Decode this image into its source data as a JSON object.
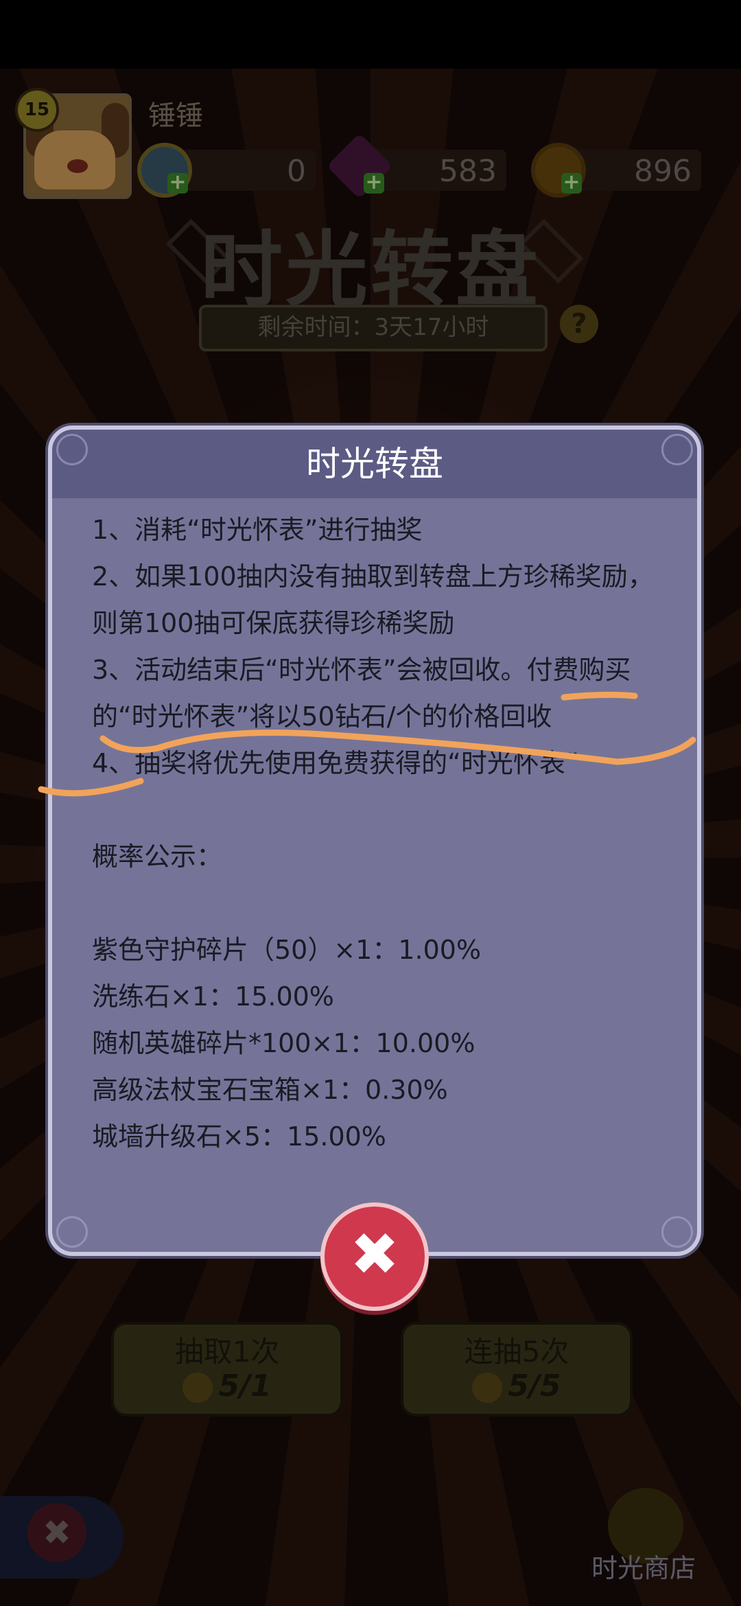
{
  "header": {
    "level": "15",
    "player_name": "锤锤",
    "resources": [
      {
        "icon": "blue-gem-coin-icon",
        "value": "0"
      },
      {
        "icon": "purple-diamond-icon",
        "value": "583"
      },
      {
        "icon": "gold-coin-icon",
        "value": "896"
      }
    ]
  },
  "event": {
    "title": "时光转盘",
    "remaining_time": "剩余时间：3天17小时",
    "help_label": "?"
  },
  "dialog": {
    "title": "时光转盘",
    "rules": [
      "1、消耗“时光怀表”进行抽奖",
      "2、如果100抽内没有抽取到转盘上方珍稀奖励，则第100抽可保底获得珍稀奖励",
      "3、活动结束后“时光怀表”会被回收。付费购买的“时光怀表”将以50钻石/个的价格回收",
      "4、抽奖将优先使用免费获得的“时光怀表”"
    ],
    "prob_heading": "概率公示：",
    "probabilities": [
      "紫色守护碎片（50）×1：1.00%",
      "洗练石×1：15.00%",
      "随机英雄碎片*100×1：10.00%",
      "高级法杖宝石宝箱×1：0.30%",
      "城墙升级石×5：15.00%"
    ],
    "close_label": "✖"
  },
  "actions": {
    "draw_once_label": "抽取1次",
    "draw_once_count": "5/1",
    "draw_five_label": "连抽5次",
    "draw_five_count": "5/5",
    "shop_label": "时光商店",
    "side_close_label": "✖"
  },
  "colors": {
    "dialog_bg": "#757498",
    "dialog_header": "#5c5b84",
    "close_red": "#d0384e",
    "annotation_orange": "#f2a35a"
  }
}
